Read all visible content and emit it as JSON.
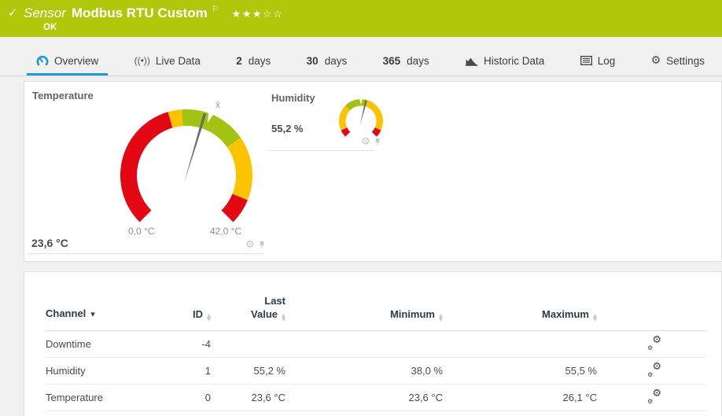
{
  "header": {
    "kind": "Sensor",
    "title": "Modbus RTU Custom",
    "status": "OK",
    "stars_filled": "★★★",
    "stars_empty": "☆☆",
    "priority": "3 of 5 stars"
  },
  "icons": {
    "check": "✓",
    "flag": "⚐",
    "live_data": "((•))",
    "gear": "⚙",
    "sort_up": "▲",
    "sort_down": "▼",
    "caret_down": "▾",
    "avg_mean": "x̄"
  },
  "tabs": {
    "overview": "Overview",
    "live_data": "Live Data",
    "d2_num": "2",
    "d30_num": "30",
    "d365_num": "365",
    "days": "days",
    "historic": "Historic Data",
    "log": "Log",
    "settings": "Settings"
  },
  "gauges": {
    "temperature": {
      "title": "Temperature",
      "value": "23,6 °C",
      "value_num": 23.6,
      "min_label": "0,0 °C",
      "max_label": "42,0 °C",
      "range": [
        0,
        42
      ],
      "bands": [
        {
          "color": "#e30613",
          "from": 0.0,
          "to": 0.44
        },
        {
          "color": "#fdc300",
          "from": 0.44,
          "to": 0.485
        },
        {
          "color": "#a3c312",
          "from": 0.485,
          "to": 0.705
        },
        {
          "color": "#fdc300",
          "from": 0.705,
          "to": 0.915
        },
        {
          "color": "#e30613",
          "from": 0.915,
          "to": 1.0
        }
      ]
    },
    "humidity": {
      "title": "Humidity",
      "value": "55,2 %",
      "value_num": 55.2,
      "range": [
        0,
        100
      ],
      "bands": [
        {
          "color": "#e30613",
          "from": 0.0,
          "to": 0.075
        },
        {
          "color": "#fdc300",
          "from": 0.075,
          "to": 0.33
        },
        {
          "color": "#a3c312",
          "from": 0.33,
          "to": 0.55
        },
        {
          "color": "#fdc300",
          "from": 0.55,
          "to": 0.925
        },
        {
          "color": "#e30613",
          "from": 0.925,
          "to": 1.0
        }
      ]
    }
  },
  "table": {
    "headers": {
      "channel": "Channel",
      "id": "ID",
      "last1": "Last",
      "last2": "Value",
      "min": "Minimum",
      "max": "Maximum"
    },
    "rows": [
      {
        "channel": "Downtime",
        "id": "-4",
        "last": "",
        "min": "",
        "max": ""
      },
      {
        "channel": "Humidity",
        "id": "1",
        "last": "55,2 %",
        "min": "38,0 %",
        "max": "55,5 %"
      },
      {
        "channel": "Temperature",
        "id": "0",
        "last": "23,6 °C",
        "min": "23,6 °C",
        "max": "26,1 °C"
      }
    ]
  },
  "colors": {
    "ok_green": "#aec90b",
    "accent_blue": "#1d9bd9",
    "gauge_red": "#e30613",
    "gauge_yellow": "#fdc300",
    "gauge_green": "#a3c312"
  }
}
